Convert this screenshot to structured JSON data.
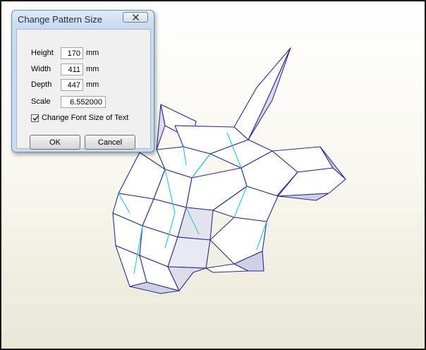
{
  "dialog": {
    "title": "Change Pattern Size",
    "close_icon": "close-icon",
    "fields": {
      "height": {
        "label": "Height",
        "value": "170",
        "unit": "mm"
      },
      "width": {
        "label": "Width",
        "value": "411",
        "unit": "mm"
      },
      "depth": {
        "label": "Depth",
        "value": "447",
        "unit": "mm"
      },
      "scale": {
        "label": "Scale",
        "value": "6.552000"
      }
    },
    "change_font_checkbox": {
      "label": "Change Font Size of Text",
      "checked": true
    },
    "ok_label": "OK",
    "cancel_label": "Cancel"
  },
  "viewport": {
    "subject": "3d-polygon-unicorn-head-model",
    "colors": {
      "background": "#f7f6ee",
      "face": "#ffffff",
      "shaded_face": "#d8d8e6",
      "edge": "#2b2b8c",
      "fold_line": "#31c8e0"
    }
  }
}
